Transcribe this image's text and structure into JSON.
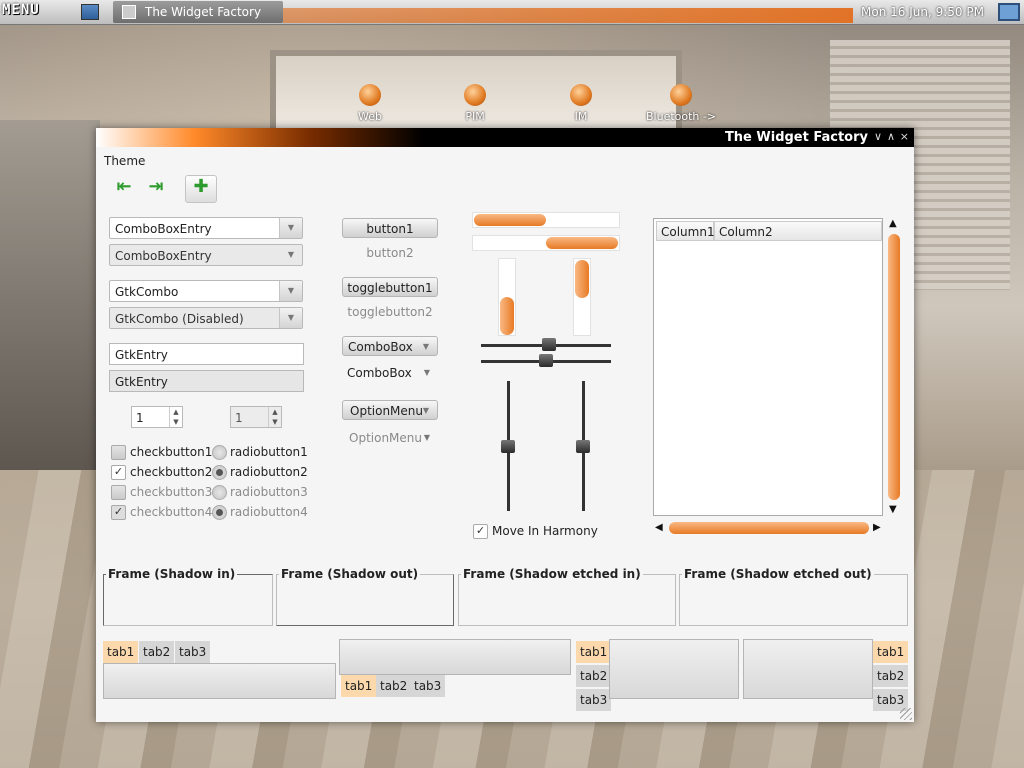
{
  "desktop": {
    "menu_label": "MENU",
    "taskbar_item": "The Widget Factory",
    "clock": "Mon 16 Jun,  9:50 PM",
    "launchers": [
      "Web",
      "PIM",
      "IM",
      "Bluetooth ->"
    ]
  },
  "window": {
    "title": "The Widget Factory",
    "menu": "Theme",
    "combos": {
      "cbe1": "ComboBoxEntry",
      "cbe2": "ComboBoxEntry",
      "gtk1": "GtkCombo",
      "gtk2": "GtkCombo (Disabled)"
    },
    "entries": {
      "e1": "GtkEntry",
      "e2": "GtkEntry"
    },
    "spins": {
      "s1": "1",
      "s2": "1"
    },
    "checks": [
      "checkbutton1",
      "checkbutton2",
      "checkbutton3",
      "checkbutton4"
    ],
    "radios": [
      "radiobutton1",
      "radiobutton2",
      "radiobutton3",
      "radiobutton4"
    ],
    "buttons": {
      "b1": "button1",
      "b2": "button2",
      "t1": "togglebutton1",
      "t2": "togglebutton2",
      "cb1": "ComboBox",
      "cb2": "ComboBox",
      "om1": "OptionMenu",
      "om2": "OptionMenu"
    },
    "harmony": "Move In Harmony",
    "tree_columns": [
      "Column1",
      "Column2"
    ],
    "frames": [
      "Frame (Shadow in)",
      "Frame (Shadow out)",
      "Frame (Shadow etched in)",
      "Frame (Shadow etched out)"
    ],
    "tabs": [
      "tab1",
      "tab2",
      "tab3"
    ]
  }
}
